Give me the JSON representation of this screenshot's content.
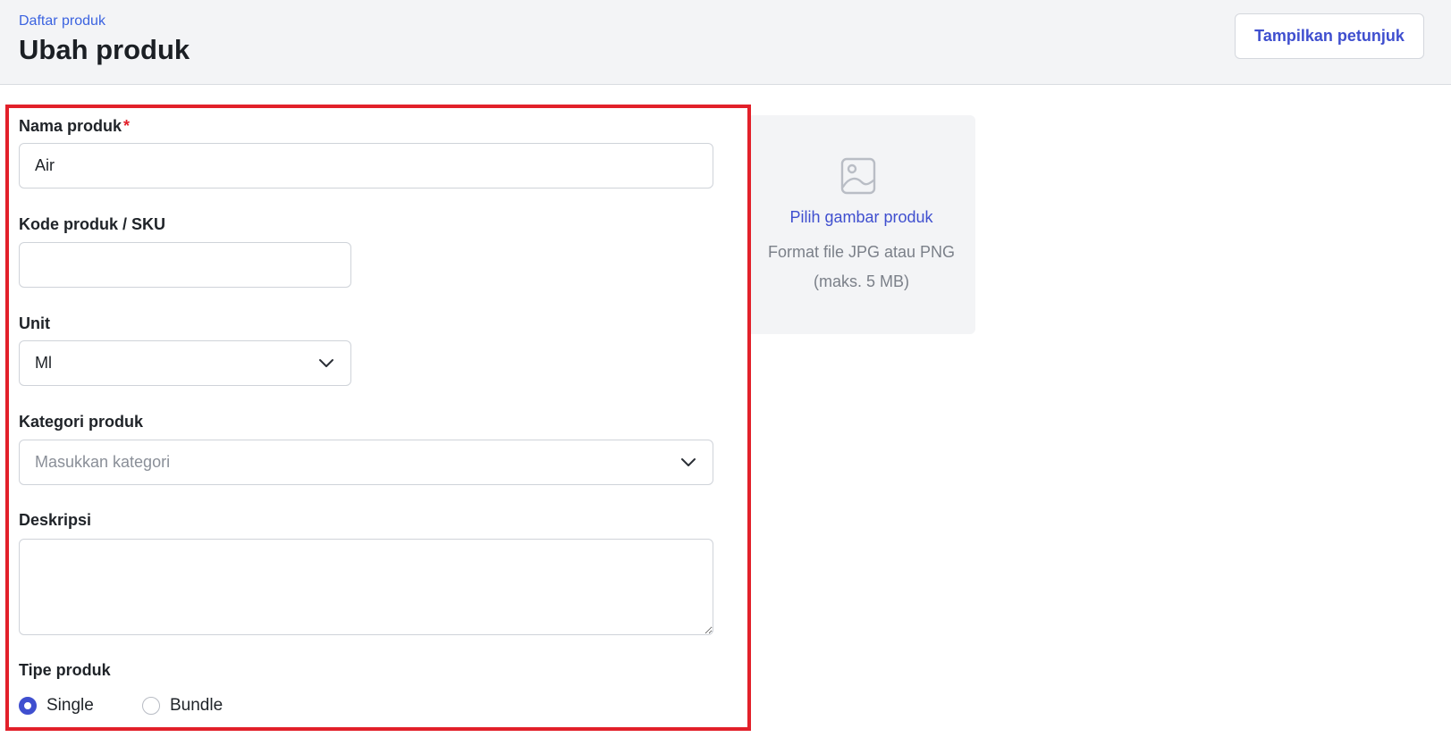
{
  "header": {
    "breadcrumb": "Daftar produk",
    "title": "Ubah produk",
    "guide_button": "Tampilkan petunjuk"
  },
  "form": {
    "name": {
      "label": "Nama produk",
      "required_mark": "*",
      "value": "Air"
    },
    "sku": {
      "label": "Kode produk / SKU",
      "value": ""
    },
    "unit": {
      "label": "Unit",
      "selected": "Ml",
      "icon": "chevron-down-icon"
    },
    "category": {
      "label": "Kategori produk",
      "placeholder": "Masukkan kategori",
      "icon": "chevron-down-icon"
    },
    "description": {
      "label": "Deskripsi",
      "value": ""
    },
    "product_type": {
      "label": "Tipe produk",
      "options": [
        {
          "label": "Single",
          "checked": true
        },
        {
          "label": "Bundle",
          "checked": false
        }
      ]
    }
  },
  "image_upload": {
    "icon": "image-icon",
    "link": "Pilih gambar produk",
    "hint": "Format file JPG atau PNG (maks. 5 MB)"
  },
  "colors": {
    "accent": "#3f4fcf",
    "link": "#3b63e0",
    "highlight": "#e2202a",
    "header_bg": "#f3f4f6"
  }
}
